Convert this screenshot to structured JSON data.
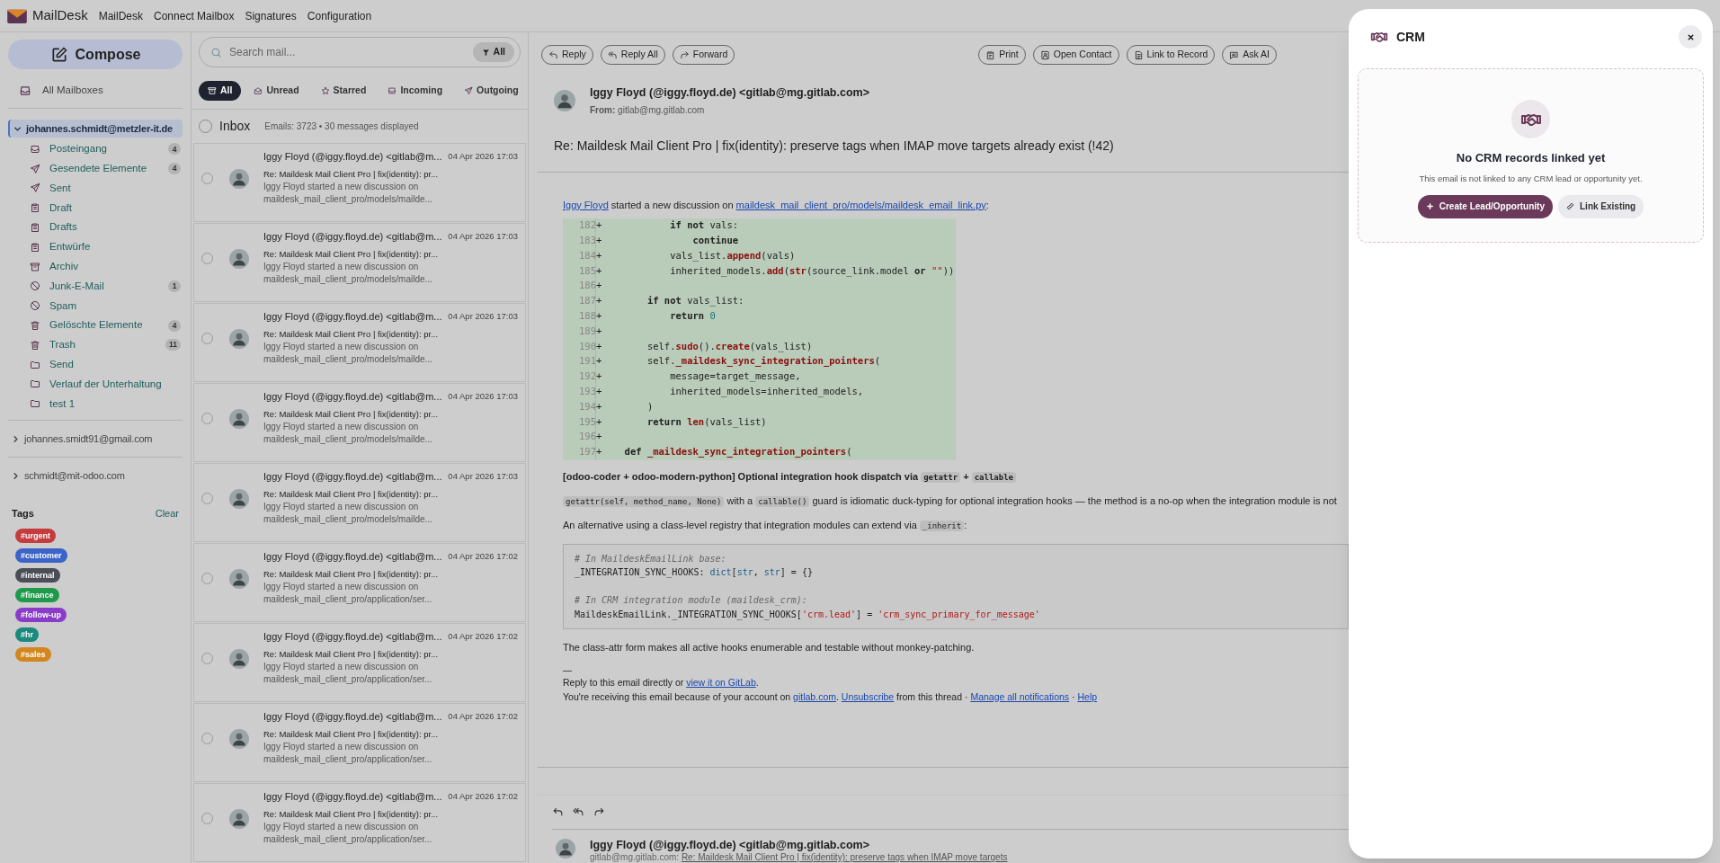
{
  "top_bar": {
    "app_name": "MailDesk",
    "menu": [
      "MailDesk",
      "Connect Mailbox",
      "Signatures",
      "Configuration"
    ]
  },
  "sidebar": {
    "compose": "Compose",
    "all_mailboxes": "All Mailboxes",
    "accounts": [
      {
        "email": "johannes.schmidt@metzler-it.de",
        "expanded": true,
        "selected": true,
        "folders": [
          {
            "name": "Posteingang",
            "kind": "inbox",
            "count": "4"
          },
          {
            "name": "Gesendete Elemente",
            "kind": "sent",
            "count": "4"
          },
          {
            "name": "Sent",
            "kind": "sent"
          },
          {
            "name": "Draft",
            "kind": "draft"
          },
          {
            "name": "Drafts",
            "kind": "draft"
          },
          {
            "name": "Entwürfe",
            "kind": "draft"
          },
          {
            "name": "Archiv",
            "kind": "archive"
          },
          {
            "name": "Junk-E-Mail",
            "kind": "blocked",
            "count": "1"
          },
          {
            "name": "Spam",
            "kind": "blocked"
          },
          {
            "name": "Gelöschte Elemente",
            "kind": "trash",
            "count": "4"
          },
          {
            "name": "Trash",
            "kind": "trash",
            "count": "11"
          },
          {
            "name": "Send",
            "kind": "folder"
          },
          {
            "name": "Verlauf der Unterhaltung",
            "kind": "folder"
          },
          {
            "name": "test 1",
            "kind": "folder"
          }
        ]
      },
      {
        "email": "johannes.smidt91@gmail.com",
        "expanded": false,
        "selected": false
      },
      {
        "email": "schmidt@mit-odoo.com",
        "expanded": false,
        "selected": false
      }
    ],
    "tags": {
      "title": "Tags",
      "clear": "Clear",
      "items": [
        {
          "label": "#urgent",
          "color": "#c43c3c"
        },
        {
          "label": "#customer",
          "color": "#3b63c8"
        },
        {
          "label": "#internal",
          "color": "#4b4e57"
        },
        {
          "label": "#finance",
          "color": "#1f9a4b"
        },
        {
          "label": "#follow-up",
          "color": "#8a3cc8"
        },
        {
          "label": "#hr",
          "color": "#1b8a7c"
        },
        {
          "label": "#sales",
          "color": "#d3861e"
        }
      ]
    }
  },
  "mail_list": {
    "search_placeholder": "Search mail...",
    "filter_button": "All",
    "filters": [
      {
        "label": "All",
        "kind": "all",
        "selected": true
      },
      {
        "label": "Unread",
        "kind": "unread",
        "selected": false
      },
      {
        "label": "Starred",
        "kind": "starred",
        "selected": false
      },
      {
        "label": "Incoming",
        "kind": "incoming",
        "selected": false
      },
      {
        "label": "Outgoing",
        "kind": "outgoing",
        "selected": false
      }
    ],
    "folder_title": "Inbox",
    "folder_info": "Emails: 3723 • 30 messages displayed",
    "select_all": false,
    "messages": [
      {
        "sender": "Iggy Floyd (@iggy.floyd.de) <gitlab@m...",
        "date": "04 Apr 2026 17:03",
        "subject": "Re: Maildesk Mail Client Pro | fix(identity): pr...",
        "preview": [
          "Iggy Floyd started a new discussion on",
          "maildesk_mail_client_pro/models/mailde..."
        ],
        "selected": false
      },
      {
        "sender": "Iggy Floyd (@iggy.floyd.de) <gitlab@m...",
        "date": "04 Apr 2026 17:03",
        "subject": "Re: Maildesk Mail Client Pro | fix(identity): pr...",
        "preview": [
          "Iggy Floyd started a new discussion on",
          "maildesk_mail_client_pro/models/mailde..."
        ],
        "selected": false
      },
      {
        "sender": "Iggy Floyd (@iggy.floyd.de) <gitlab@m...",
        "date": "04 Apr 2026 17:03",
        "subject": "Re: Maildesk Mail Client Pro | fix(identity): pr...",
        "preview": [
          "Iggy Floyd started a new discussion on",
          "maildesk_mail_client_pro/models/mailde..."
        ],
        "selected": false
      },
      {
        "sender": "Iggy Floyd (@iggy.floyd.de) <gitlab@m...",
        "date": "04 Apr 2026 17:03",
        "subject": "Re: Maildesk Mail Client Pro | fix(identity): pr...",
        "preview": [
          "Iggy Floyd started a new discussion on",
          "maildesk_mail_client_pro/models/mailde..."
        ],
        "selected": false
      },
      {
        "sender": "Iggy Floyd (@iggy.floyd.de) <gitlab@m...",
        "date": "04 Apr 2026 17:03",
        "subject": "Re: Maildesk Mail Client Pro | fix(identity): pr...",
        "preview": [
          "Iggy Floyd started a new discussion on",
          "maildesk_mail_client_pro/models/mailde..."
        ],
        "selected": false
      },
      {
        "sender": "Iggy Floyd (@iggy.floyd.de) <gitlab@m...",
        "date": "04 Apr 2026 17:02",
        "subject": "Re: Maildesk Mail Client Pro | fix(identity): pr...",
        "preview": [
          "Iggy Floyd started a new discussion on",
          "maildesk_mail_client_pro/application/ser..."
        ],
        "selected": false
      },
      {
        "sender": "Iggy Floyd (@iggy.floyd.de) <gitlab@m...",
        "date": "04 Apr 2026 17:02",
        "subject": "Re: Maildesk Mail Client Pro | fix(identity): pr...",
        "preview": [
          "Iggy Floyd started a new discussion on",
          "maildesk_mail_client_pro/application/ser..."
        ],
        "selected": false
      },
      {
        "sender": "Iggy Floyd (@iggy.floyd.de) <gitlab@m...",
        "date": "04 Apr 2026 17:02",
        "subject": "Re: Maildesk Mail Client Pro | fix(identity): pr...",
        "preview": [
          "Iggy Floyd started a new discussion on",
          "maildesk_mail_client_pro/application/ser..."
        ],
        "selected": false
      },
      {
        "sender": "Iggy Floyd (@iggy.floyd.de) <gitlab@m...",
        "date": "04 Apr 2026 17:02",
        "subject": "Re: Maildesk Mail Client Pro | fix(identity): pr...",
        "preview": [
          "Iggy Floyd started a new discussion on",
          "maildesk_mail_client_pro/application/ser..."
        ],
        "selected": false
      }
    ]
  },
  "reader": {
    "toolbar_left": [
      {
        "label": "Reply",
        "kind": "reply"
      },
      {
        "label": "Reply All",
        "kind": "reply_all"
      },
      {
        "label": "Forward",
        "kind": "forward"
      }
    ],
    "toolbar_right": [
      {
        "label": "Print",
        "kind": "print"
      },
      {
        "label": "Open Contact",
        "kind": "contact"
      },
      {
        "label": "Link to Record",
        "kind": "document"
      },
      {
        "label": "Ask AI",
        "kind": "ai"
      }
    ],
    "sender": "Iggy Floyd (@iggy.floyd.de) <gitlab@mg.gitlab.com>",
    "from_label": "From:",
    "from": "gitlab@mg.gitlab.com",
    "subject": "Re: Maildesk Mail Client Pro | fix(identity): preserve tags when IMAP move targets already exist (!42)",
    "body": [
      {
        "kind": "paragraph",
        "bold": false,
        "segments": [
          {
            "text": "Iggy Floyd",
            "kind": "link"
          },
          {
            "text": " started a new discussion on ",
            "kind": "plain"
          },
          {
            "text": "maildesk_mail_client_pro/models/maildesk_email_link.py",
            "kind": "link"
          },
          {
            "text": ":",
            "kind": "plain"
          }
        ]
      },
      {
        "kind": "diff",
        "lines": [
          {
            "number": "182",
            "sign": "+",
            "tokens": [
              {
                "text": "            if not",
                "kind": "keyword"
              },
              {
                "text": " vals:",
                "kind": "plain"
              }
            ]
          },
          {
            "number": "183",
            "sign": "+",
            "tokens": [
              {
                "text": "                continue",
                "kind": "keyword"
              }
            ]
          },
          {
            "number": "184",
            "sign": "+",
            "tokens": [
              {
                "text": "            vals_list.",
                "kind": "plain"
              },
              {
                "text": "append",
                "kind": "function"
              },
              {
                "text": "(vals)",
                "kind": "plain"
              }
            ]
          },
          {
            "number": "185",
            "sign": "+",
            "tokens": [
              {
                "text": "            inherited_models.",
                "kind": "plain"
              },
              {
                "text": "add",
                "kind": "function"
              },
              {
                "text": "(",
                "kind": "plain"
              },
              {
                "text": "str",
                "kind": "function"
              },
              {
                "text": "(source_link.model ",
                "kind": "plain"
              },
              {
                "text": "or ",
                "kind": "keyword"
              },
              {
                "text": "\"\"",
                "kind": "string"
              },
              {
                "text": "))",
                "kind": "plain"
              }
            ]
          },
          {
            "number": "186",
            "sign": "+"
          },
          {
            "number": "187",
            "sign": "+",
            "tokens": [
              {
                "text": "        if not",
                "kind": "keyword"
              },
              {
                "text": " vals_list:",
                "kind": "plain"
              }
            ]
          },
          {
            "number": "188",
            "sign": "+",
            "tokens": [
              {
                "text": "            return ",
                "kind": "keyword"
              },
              {
                "text": "0",
                "kind": "number"
              }
            ]
          },
          {
            "number": "189",
            "sign": "+"
          },
          {
            "number": "190",
            "sign": "+",
            "tokens": [
              {
                "text": "        self.",
                "kind": "plain"
              },
              {
                "text": "sudo",
                "kind": "function"
              },
              {
                "text": "().",
                "kind": "plain"
              },
              {
                "text": "create",
                "kind": "function"
              },
              {
                "text": "(vals_list)",
                "kind": "plain"
              }
            ]
          },
          {
            "number": "191",
            "sign": "+",
            "tokens": [
              {
                "text": "        self.",
                "kind": "plain"
              },
              {
                "text": "_maildesk_sync_integration_pointers",
                "kind": "function"
              },
              {
                "text": "(",
                "kind": "plain"
              }
            ]
          },
          {
            "number": "192",
            "sign": "+",
            "tokens": [
              {
                "text": "            message=target_message,",
                "kind": "plain"
              }
            ]
          },
          {
            "number": "193",
            "sign": "+",
            "tokens": [
              {
                "text": "            inherited_models=inherited_models,",
                "kind": "plain"
              }
            ]
          },
          {
            "number": "194",
            "sign": "+",
            "tokens": [
              {
                "text": "        )",
                "kind": "plain"
              }
            ]
          },
          {
            "number": "195",
            "sign": "+",
            "tokens": [
              {
                "text": "        return ",
                "kind": "keyword"
              },
              {
                "text": "len",
                "kind": "function"
              },
              {
                "text": "(vals_list)",
                "kind": "plain"
              }
            ]
          },
          {
            "number": "196",
            "sign": "+"
          },
          {
            "number": "197",
            "sign": "+",
            "tokens": [
              {
                "text": "    def ",
                "kind": "keyword"
              },
              {
                "text": "_maildesk_sync_integration_pointers",
                "kind": "function"
              },
              {
                "text": "(",
                "kind": "plain"
              }
            ]
          }
        ]
      },
      {
        "kind": "paragraph",
        "bold": true,
        "segments": [
          {
            "text": "[odoo-coder + odoo-modern-python] Optional integration hook dispatch via ",
            "kind": "plain"
          },
          {
            "text": "getattr",
            "kind": "code"
          },
          {
            "text": " + ",
            "kind": "plain"
          },
          {
            "text": "callable",
            "kind": "code"
          }
        ]
      },
      {
        "kind": "paragraph",
        "bold": false,
        "segments": [
          {
            "text": "getattr(self, method_name, None)",
            "kind": "code"
          },
          {
            "text": " with a ",
            "kind": "plain"
          },
          {
            "text": "callable()",
            "kind": "code"
          },
          {
            "text": " guard is idiomatic duck-typing for optional integration hooks — the method is a no-op when the integration module is not",
            "kind": "plain"
          }
        ]
      },
      {
        "kind": "paragraph",
        "bold": false,
        "segments": [
          {
            "text": "An alternative using a class-level registry that integration modules can extend via ",
            "kind": "plain"
          },
          {
            "text": "_inherit",
            "kind": "code"
          },
          {
            "text": ":",
            "kind": "plain"
          }
        ]
      },
      {
        "kind": "code_block",
        "lines": [
          {
            "tokens": [
              {
                "text": "# In MaildeskEmailLink base:",
                "kind": "comment"
              }
            ]
          },
          {
            "tokens": [
              {
                "text": "_INTEGRATION_SYNC_HOOKS: ",
                "kind": "plain"
              },
              {
                "text": "dict",
                "kind": "builtin"
              },
              {
                "text": "[",
                "kind": "plain"
              },
              {
                "text": "str",
                "kind": "builtin"
              },
              {
                "text": ", ",
                "kind": "plain"
              },
              {
                "text": "str",
                "kind": "builtin"
              },
              {
                "text": "] = {}",
                "kind": "plain"
              }
            ]
          },
          {
            "kind": "blank"
          },
          {
            "tokens": [
              {
                "text": "# In CRM integration module (maildesk_crm):",
                "kind": "comment"
              }
            ]
          },
          {
            "tokens": [
              {
                "text": "MaildeskEmailLink._INTEGRATION_SYNC_HOOKS[",
                "kind": "plain"
              },
              {
                "text": "'crm.lead'",
                "kind": "string"
              },
              {
                "text": "] = ",
                "kind": "plain"
              },
              {
                "text": "'crm_sync_primary_for_message'",
                "kind": "string"
              }
            ]
          }
        ]
      },
      {
        "kind": "paragraph",
        "bold": false,
        "segments": [
          {
            "text": "The class-attr form makes all active hooks enumerable and testable without monkey-patching.",
            "kind": "plain"
          }
        ]
      },
      {
        "kind": "signature",
        "segments": [
          {
            "text": "—",
            "kind": "plain"
          }
        ]
      },
      {
        "kind": "footer",
        "segments": [
          {
            "text": "Reply to this email directly or ",
            "kind": "plain"
          },
          {
            "text": "view it on GitLab",
            "kind": "link"
          },
          {
            "text": ".",
            "kind": "plain"
          }
        ]
      },
      {
        "kind": "footer",
        "segments": [
          {
            "text": "You're receiving this email because of your account on ",
            "kind": "plain"
          },
          {
            "text": "gitlab.com",
            "kind": "link"
          },
          {
            "text": ". ",
            "kind": "plain"
          },
          {
            "text": "Unsubscribe",
            "kind": "link"
          },
          {
            "text": " from this thread · ",
            "kind": "plain"
          },
          {
            "text": "Manage all notifications",
            "kind": "link"
          },
          {
            "text": " · ",
            "kind": "plain"
          },
          {
            "text": "Help",
            "kind": "link"
          }
        ]
      }
    ],
    "thread_next": {
      "actions": [
        {
          "kind": "reply"
        },
        {
          "kind": "reply_all"
        },
        {
          "kind": "forward"
        }
      ],
      "sender": "Iggy Floyd (@iggy.floyd.de) <gitlab@mg.gitlab.com>",
      "from": "gitlab@mg.gitlab.com:",
      "snippet": "Re: Maildesk Mail Client Pro | fix(identity): preserve tags when IMAP move targets"
    }
  },
  "crm_panel": {
    "title": "CRM",
    "empty_title": "No CRM records linked yet",
    "empty_text": "This email is not linked to any CRM lead or opportunity yet.",
    "buttons": [
      {
        "label": "Create Lead/Opportunity",
        "kind": "primary"
      },
      {
        "label": "Link Existing",
        "kind": "secondary"
      }
    ]
  }
}
